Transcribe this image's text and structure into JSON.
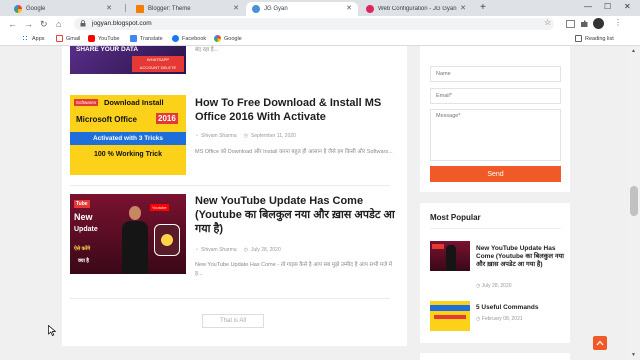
{
  "browser": {
    "tabs": [
      {
        "title": "Google",
        "active": false
      },
      {
        "title": "Blogger: Theme",
        "active": false
      },
      {
        "title": "JG Gyan",
        "active": true
      },
      {
        "title": "Web Configuration - JG Gyan | Co",
        "active": false
      }
    ],
    "new_tab": "+",
    "url": "jogyan.blogspot.com",
    "bookmarks": [
      "Apps",
      "Gmail",
      "YouTube",
      "Translate",
      "Facebook",
      "Google"
    ],
    "reading_list": "Reading list"
  },
  "posts": [
    {
      "thumb_text": [
        "SHARE YOUR DATA",
        "WHATSAPP",
        "ACCOUNT DELETE"
      ],
      "excerpt": "बंद रहा है..."
    },
    {
      "thumb_text": [
        "Softwares",
        "Download Install",
        "Microsoft Office",
        "2016",
        "Activated with 3 Tricks",
        "100 % Working Trick"
      ],
      "title": "How To Free Download & Install MS Office 2016 With Activate",
      "author": "Shivam Sharma",
      "date": "September 11, 2020",
      "excerpt": "MS Office को Download और Install करना बहुत ही आसान है जैसे हम किसी और Softwars..."
    },
    {
      "thumb_text": [
        "Tube",
        "Youtube",
        "New",
        "Update",
        "ऐसे करेंगे",
        "क्या है"
      ],
      "title": "New YouTube Update Has Come (Youtube का बिलकुल नया और ख़ास अपडेट आ गया है)",
      "author": "Shivam Sharma",
      "date": "July 28, 2020",
      "excerpt": "New YouTube Update Has Come   - तो गाइस कैसे है आप सब मुझे उम्मीद है आप सभी मजे में ह..."
    }
  ],
  "thats_all": "That is All",
  "contact": {
    "name_placeholder": "Name",
    "email_placeholder": "Email*",
    "message_placeholder": "Message*",
    "send_label": "Send"
  },
  "most_popular": {
    "title": "Most Popular",
    "items": [
      {
        "title": "New YouTube Update Has Come (Youtube का बिलकुल नया और ख़ास अपडेट आ गया है)",
        "date": "July 28, 2020"
      },
      {
        "title": "5 Useful Commands",
        "date": "February 08, 2021"
      }
    ]
  },
  "colors": {
    "accent": "#f05a28",
    "youtube": "#ff0000"
  }
}
